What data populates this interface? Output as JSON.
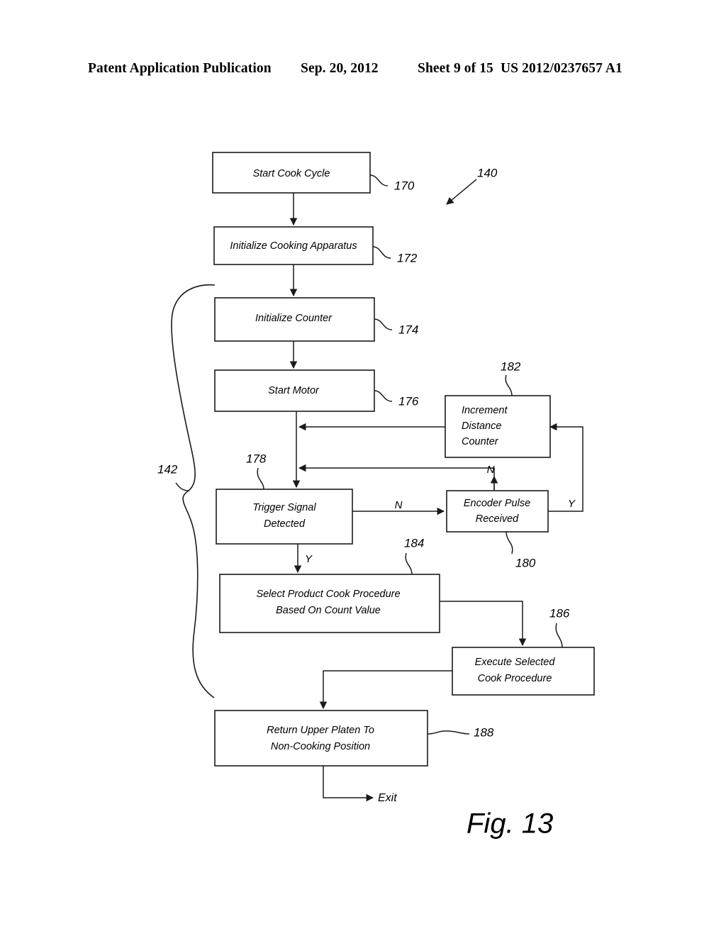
{
  "header": {
    "publication": "Patent Application Publication",
    "date": "Sep. 20, 2012",
    "sheet": "Sheet 9 of 15",
    "patent_number": "US 2012/0237657 A1"
  },
  "figure": {
    "caption": "Fig. 13",
    "diagram_ref": "140",
    "brace_ref": "142",
    "exit_label": "Exit"
  },
  "nodes": {
    "start_cook_cycle": {
      "label": "Start Cook Cycle",
      "ref": "170"
    },
    "initialize_cooking_apparatus": {
      "label": "Initialize Cooking Apparatus",
      "ref": "172"
    },
    "initialize_counter": {
      "label": "Initialize Counter",
      "ref": "174"
    },
    "start_motor": {
      "label": "Start Motor",
      "ref": "176"
    },
    "trigger_signal_detected": {
      "label_line1": "Trigger Signal",
      "label_line2": "Detected",
      "ref": "178"
    },
    "encoder_pulse_received": {
      "label_line1": "Encoder Pulse",
      "label_line2": "Received",
      "ref": "180"
    },
    "increment_distance_counter": {
      "label_line1": "Increment",
      "label_line2": "Distance",
      "label_line3": "Counter",
      "ref": "182"
    },
    "select_product_cook_procedure": {
      "label_line1": "Select Product Cook Procedure",
      "label_line2": "Based On Count Value",
      "ref": "184"
    },
    "execute_selected_cook_procedure": {
      "label_line1": "Execute Selected",
      "label_line2": "Cook Procedure",
      "ref": "186"
    },
    "return_upper_platen": {
      "label_line1": "Return Upper Platen To",
      "label_line2": "Non-Cooking Position",
      "ref": "188"
    }
  },
  "branches": {
    "trigger_no": "N",
    "trigger_yes": "Y",
    "encoder_no": "N",
    "encoder_yes": "Y"
  },
  "colors": {
    "ink": "#1a1a1a",
    "paper": "#ffffff"
  }
}
